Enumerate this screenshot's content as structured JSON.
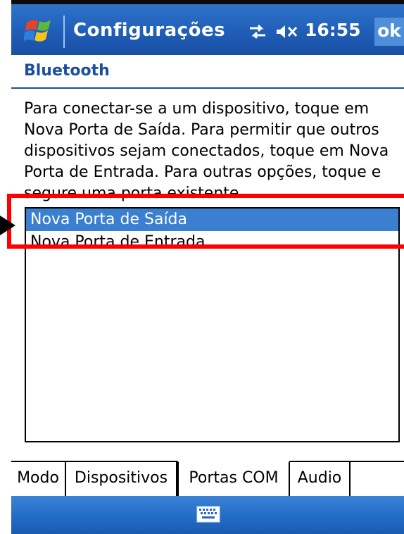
{
  "titlebar": {
    "title": "Configurações",
    "clock": "16:55",
    "ok_label": "ok",
    "icons": {
      "start": "windows-start-icon",
      "connectivity": "connectivity-icon",
      "volume": "speaker-muted-icon"
    }
  },
  "page": {
    "heading": "Bluetooth",
    "instructions": "Para conectar-se a um dispositivo, toque em Nova Porta de Saída. Para permitir que outros dispositivos sejam conectados, toque em Nova Porta de Entrada. Para outras opções, toque e segure uma porta existente."
  },
  "ports_list": {
    "items": [
      {
        "label": "Nova Porta de Saída",
        "selected": true
      },
      {
        "label": "Nova Porta de Entrada",
        "selected": false
      }
    ]
  },
  "tabs": [
    {
      "label": "Modo",
      "active": false
    },
    {
      "label": "Dispositivos",
      "active": false
    },
    {
      "label": "Portas COM",
      "active": true
    },
    {
      "label": "Audio",
      "active": false
    }
  ],
  "menubar": {
    "keyboard_icon": "keyboard-icon"
  },
  "colors": {
    "titlebar_blue": "#1f5eb8",
    "selection_blue": "#3b7fd0",
    "heading_blue": "#1a4fa0",
    "annotation_red": "#ff0000"
  }
}
